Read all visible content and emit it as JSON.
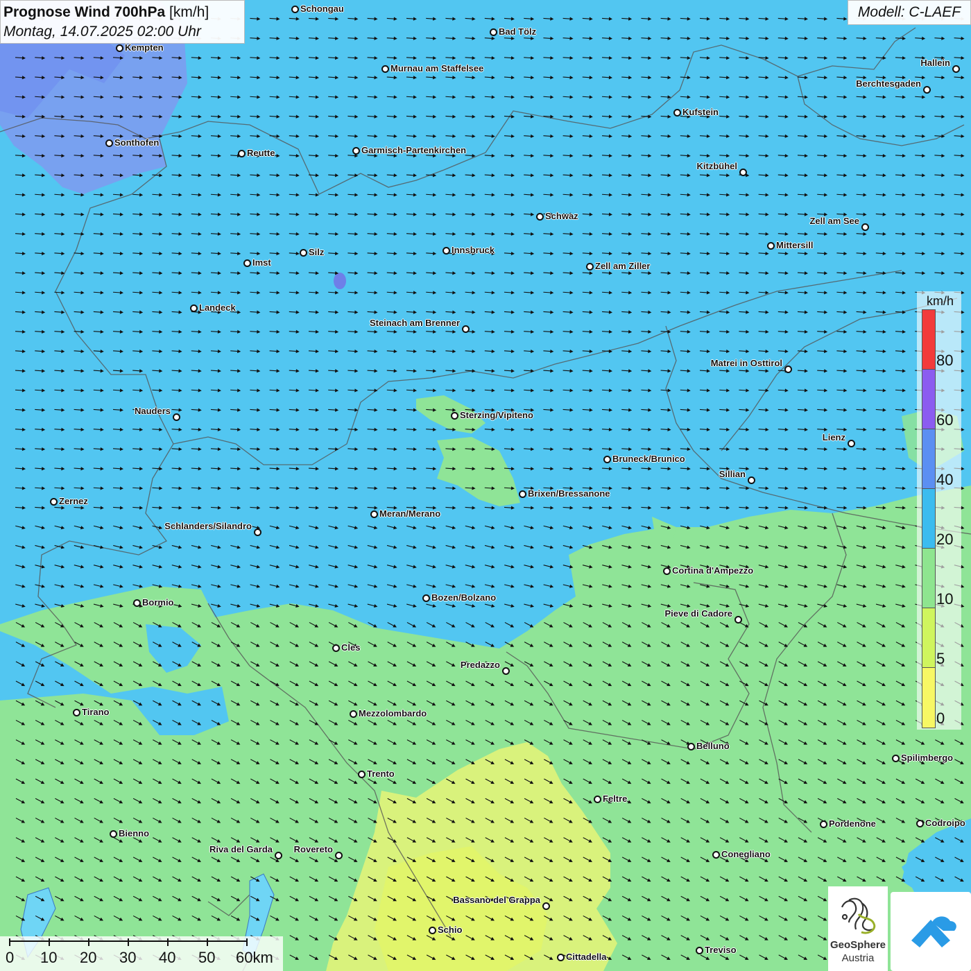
{
  "title": {
    "main": "Prognose Wind 700hPa",
    "unit": "[km/h]",
    "datetime": "Montag, 14.07.2025 02:00 Uhr"
  },
  "model": "Modell: C-LAEF",
  "legend": {
    "unit": "km/h",
    "ticks": [
      "80",
      "60",
      "40",
      "20",
      "10",
      "5",
      "0"
    ],
    "classes": [
      {
        "range": "0-5",
        "color": "#f7f864"
      },
      {
        "range": "5-10",
        "color": "#cff55e"
      },
      {
        "range": "10-20",
        "color": "#8ee58f"
      },
      {
        "range": "20-40",
        "color": "#3bbcef"
      },
      {
        "range": "40-60",
        "color": "#5b8ff2"
      },
      {
        "range": "60-80",
        "color": "#8b5cf0"
      },
      {
        "range": "80+",
        "color": "#f23b3b"
      }
    ]
  },
  "scale_bar": {
    "labels": [
      "0",
      "10",
      "20",
      "30",
      "40",
      "50",
      "60km"
    ]
  },
  "branding": {
    "line1": "GeoSphere",
    "line2": "Austria"
  },
  "cities": [
    {
      "name": "Schongau"
    },
    {
      "name": "Bad Tölz"
    },
    {
      "name": "Kempten"
    },
    {
      "name": "Murnau am Staffelsee"
    },
    {
      "name": "Hallein"
    },
    {
      "name": "Berchtesgaden"
    },
    {
      "name": "Kufstein"
    },
    {
      "name": "Sonthofen"
    },
    {
      "name": "Reutte"
    },
    {
      "name": "Garmisch-Partenkirchen"
    },
    {
      "name": "Kitzbühel"
    },
    {
      "name": "Schwaz"
    },
    {
      "name": "Zell am See"
    },
    {
      "name": "Mittersill"
    },
    {
      "name": "Innsbruck"
    },
    {
      "name": "Silz"
    },
    {
      "name": "Imst"
    },
    {
      "name": "Zell am Ziller"
    },
    {
      "name": "Landeck"
    },
    {
      "name": "Steinach am Brenner"
    },
    {
      "name": "Matrei in Osttirol"
    },
    {
      "name": "Nauders"
    },
    {
      "name": "Sterzing/Vipiteno"
    },
    {
      "name": "Lienz"
    },
    {
      "name": "Bruneck/Brunico"
    },
    {
      "name": "Sillian"
    },
    {
      "name": "Zernez"
    },
    {
      "name": "Brixen/Bressanone"
    },
    {
      "name": "Meran/Merano"
    },
    {
      "name": "Schlanders/Silandro"
    },
    {
      "name": "Cortina d'Ampezzo"
    },
    {
      "name": "Bozen/Bolzano"
    },
    {
      "name": "Bormio"
    },
    {
      "name": "Pieve di Cadore"
    },
    {
      "name": "Cles"
    },
    {
      "name": "Predazzo"
    },
    {
      "name": "Tirano"
    },
    {
      "name": "Mezzolombardo"
    },
    {
      "name": "Belluno"
    },
    {
      "name": "Spilimbergo"
    },
    {
      "name": "Trento"
    },
    {
      "name": "Feltre"
    },
    {
      "name": "Bienno"
    },
    {
      "name": "Pordenone"
    },
    {
      "name": "Codroipo"
    },
    {
      "name": "Riva del Garda"
    },
    {
      "name": "Rovereto"
    },
    {
      "name": "Conegliano"
    },
    {
      "name": "Bassano del Grappa"
    },
    {
      "name": "Schio"
    },
    {
      "name": "Treviso"
    },
    {
      "name": "Cittadella"
    }
  ]
}
